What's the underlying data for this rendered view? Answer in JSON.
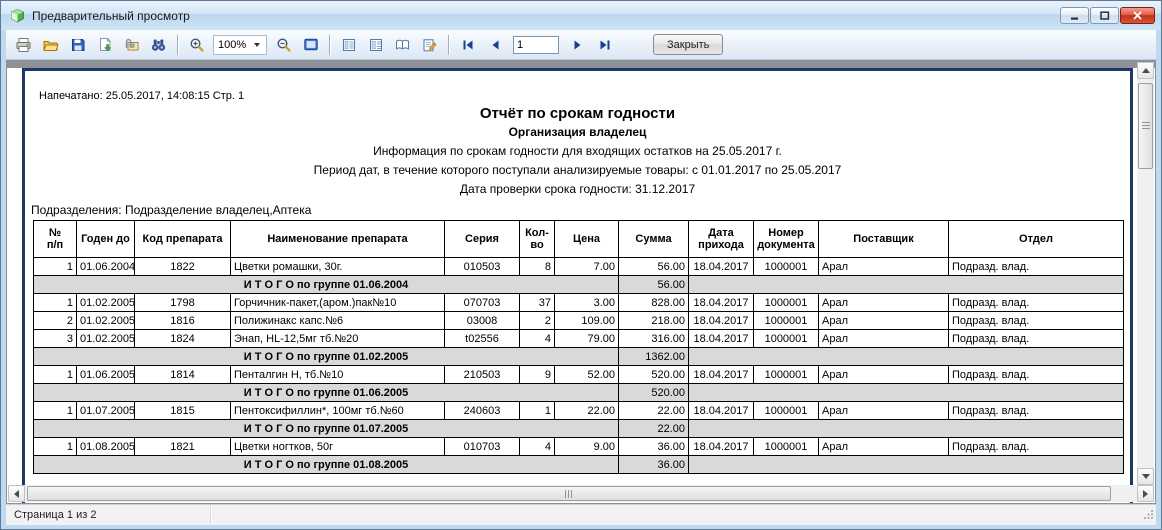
{
  "window": {
    "title": "Предварительный просмотр",
    "app_icon": "green-cube",
    "buttons": [
      "minimize",
      "maximize",
      "close"
    ]
  },
  "toolbar": {
    "icons": [
      "print",
      "open",
      "save",
      "export",
      "email",
      "find",
      "zoom-in",
      "zoom-out",
      "whole-page",
      "single-page-view",
      "multi-page-view",
      "book-view",
      "edit-page"
    ],
    "zoom_value": "100%",
    "nav": [
      "first-page",
      "prev-page",
      "next-page",
      "last-page"
    ],
    "page_input": "1",
    "close_label": "Закрыть"
  },
  "report": {
    "printed_line": "Напечатано: 25.05.2017, 14:08:15 Стр. 1",
    "title": "Отчёт по срокам годности",
    "organization": "Организация владелец",
    "info_line": "Информация по срокам годности для входящих остатков на 25.05.2017 г.",
    "period_line": "Период дат, в течение которого поступали анализируемые товары: с 01.01.2017 по 25.05.2017",
    "check_date_line": "Дата проверки срока годности: 31.12.2017",
    "subdivisions_line": "Подразделения:  Подразделение владелец,Аптека"
  },
  "table": {
    "headers": [
      "№\nп/п",
      "Годен до",
      "Код препарата",
      "Наименование препарата",
      "Серия",
      "Кол-\nво",
      "Цена",
      "Сумма",
      "Дата\nприхода",
      "Номер\nдокумента",
      "Поставщик",
      "Отдел"
    ],
    "rows": [
      {
        "type": "data",
        "cells": [
          "1",
          "01.06.2004",
          "1822",
          "Цветки ромашки, 30г.",
          "010503",
          "8",
          "7.00",
          "56.00",
          "18.04.2017",
          "1000001",
          "Арал",
          "Подразд. влад."
        ]
      },
      {
        "type": "total",
        "label": "И Т О Г О по группе 01.06.2004",
        "sum": "56.00"
      },
      {
        "type": "data",
        "cells": [
          "1",
          "01.02.2005",
          "1798",
          "Горчичник-пакет,(аром.)пак№10",
          "070703",
          "37",
          "3.00",
          "828.00",
          "18.04.2017",
          "1000001",
          "Арал",
          "Подразд. влад."
        ]
      },
      {
        "type": "data",
        "cells": [
          "2",
          "01.02.2005",
          "1816",
          "Полижинакс капс.№6",
          "03008",
          "2",
          "109.00",
          "218.00",
          "18.04.2017",
          "1000001",
          "Арал",
          "Подразд. влад."
        ]
      },
      {
        "type": "data",
        "cells": [
          "3",
          "01.02.2005",
          "1824",
          "Энап, HL-12,5мг тб.№20",
          "t02556",
          "4",
          "79.00",
          "316.00",
          "18.04.2017",
          "1000001",
          "Арал",
          "Подразд. влад."
        ]
      },
      {
        "type": "total",
        "label": "И Т О Г О по группе 01.02.2005",
        "sum": "1362.00"
      },
      {
        "type": "data",
        "cells": [
          "1",
          "01.06.2005",
          "1814",
          "Пенталгин Н, тб.№10",
          "210503",
          "9",
          "52.00",
          "520.00",
          "18.04.2017",
          "1000001",
          "Арал",
          "Подразд. влад."
        ]
      },
      {
        "type": "total",
        "label": "И Т О Г О по группе 01.06.2005",
        "sum": "520.00"
      },
      {
        "type": "data",
        "cells": [
          "1",
          "01.07.2005",
          "1815",
          "Пентоксифиллин*, 100мг тб.№60",
          "240603",
          "1",
          "22.00",
          "22.00",
          "18.04.2017",
          "1000001",
          "Арал",
          "Подразд. влад."
        ]
      },
      {
        "type": "total",
        "label": "И Т О Г О по группе 01.07.2005",
        "sum": "22.00"
      },
      {
        "type": "data",
        "cells": [
          "1",
          "01.08.2005",
          "1821",
          "Цветки ногтков, 50г",
          "010703",
          "4",
          "9.00",
          "36.00",
          "18.04.2017",
          "1000001",
          "Арал",
          "Подразд. влад."
        ]
      },
      {
        "type": "total",
        "label": "И Т О Г О по группе 01.08.2005",
        "sum": "36.00"
      }
    ]
  },
  "statusbar": {
    "page_info": "Страница 1 из 2"
  },
  "colors": {
    "titlebar_blue": "#cfe4f6",
    "page_border_navy": "#1c3867",
    "total_row_gray": "#d9d9d9",
    "close_button_red": "#c0321b"
  }
}
